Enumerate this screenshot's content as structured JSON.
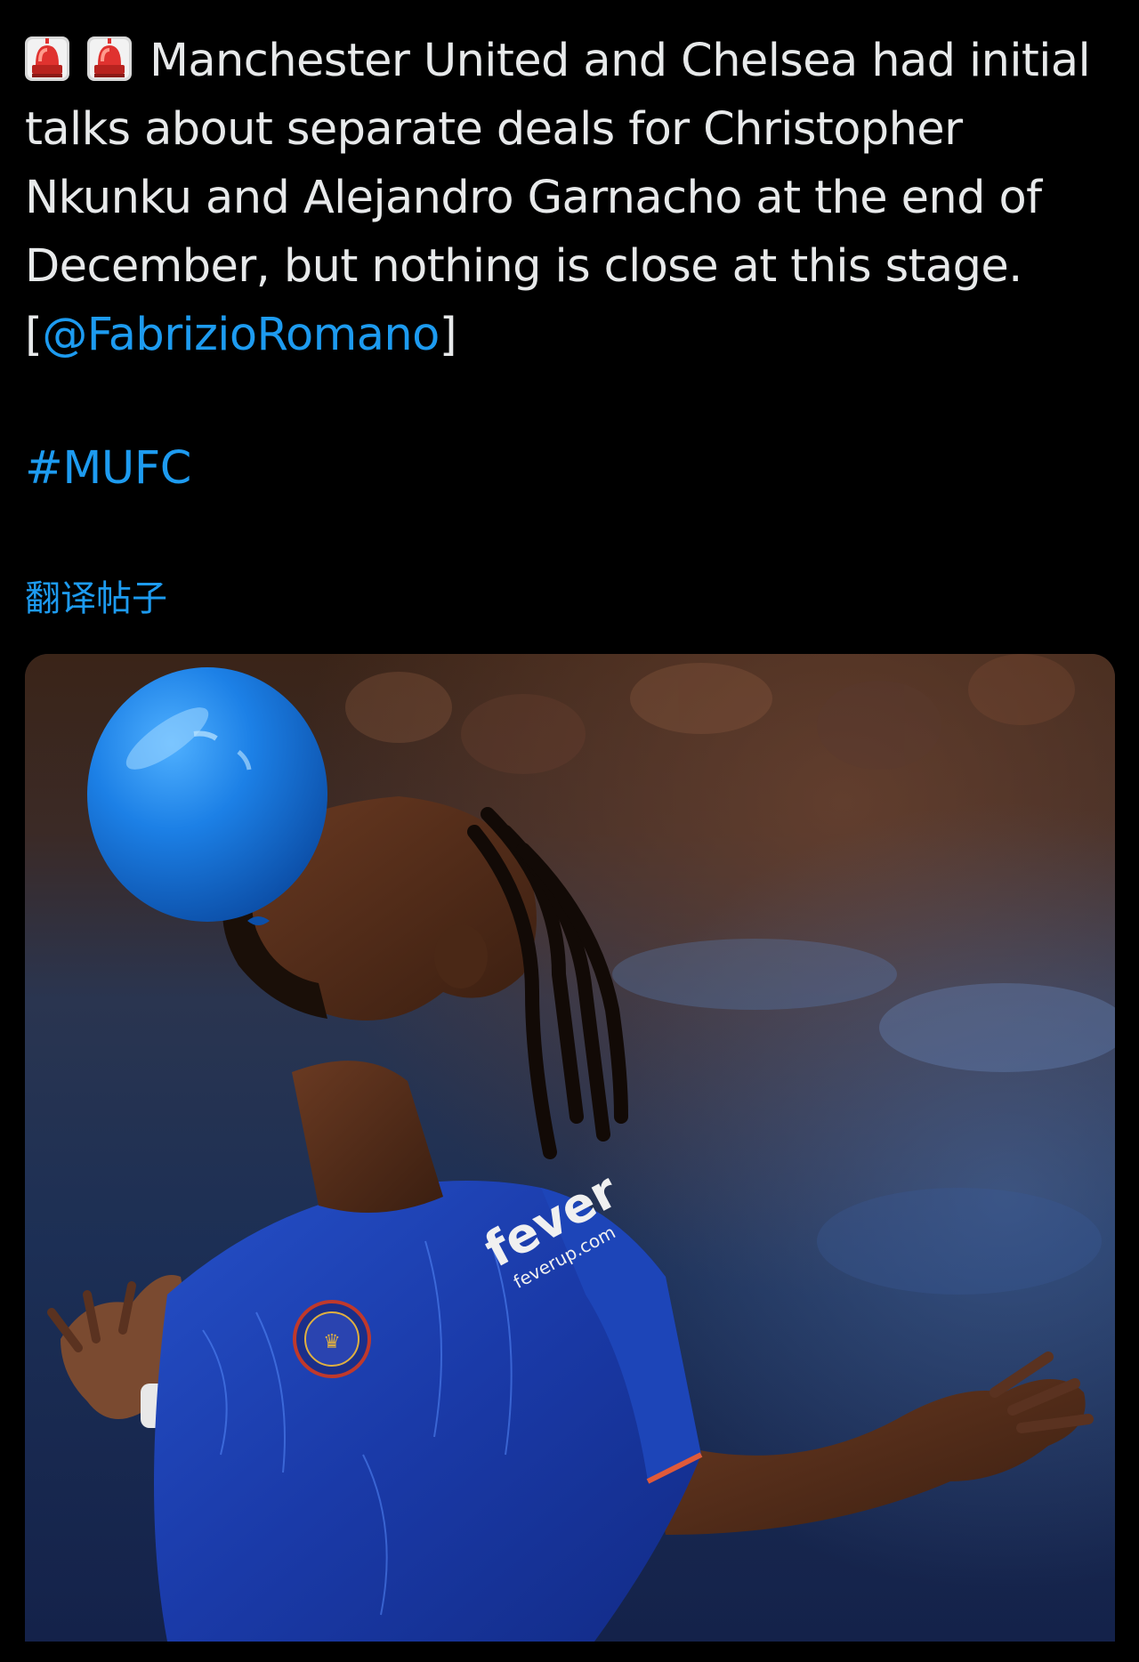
{
  "tweet": {
    "emojis": [
      "police-car-light-icon",
      "police-car-light-icon"
    ],
    "text_main": "Manchester United and Chelsea had initial talks about separate deals for Christopher Nkunku and Alejandro Garnacho at the end of December, but nothing is close at this stage.",
    "source_open": "[",
    "source_mention": "@FabrizioRomano",
    "source_close": "]",
    "hashtag": "#MUFC",
    "translate_label": "翻译帖子"
  },
  "media": {
    "alt": "Footballer in a blue kit blowing up a blue balloon with arms outstretched",
    "shirt_sponsor": "fever",
    "shirt_sleeve_text": "feverup.com"
  },
  "colors": {
    "background": "#000000",
    "text": "#e7e9ea",
    "link": "#1d9bf0"
  }
}
